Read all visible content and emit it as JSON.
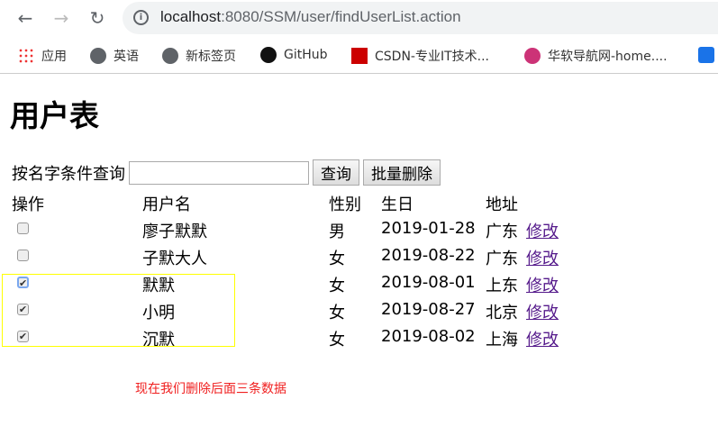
{
  "browser": {
    "url_host": "localhost",
    "url_rest": ":8080/SSM/user/findUserList.action",
    "bookmarks": [
      "应用",
      "英语",
      "新标签页",
      "GitHub",
      "CSDN-专业IT技术...",
      "华软导航网-home...."
    ]
  },
  "page": {
    "title": "用户表",
    "search_label": "按名字条件查询",
    "search_value": "",
    "query_button": "查询",
    "batch_delete_button": "批量删除",
    "headers": [
      "操作",
      "用户名",
      "性别",
      "生日",
      "地址"
    ],
    "rows": [
      {
        "checked": false,
        "name": "廖子默默",
        "gender": "男",
        "birthday": "2019-01-28",
        "address": "广东",
        "edit": "修改"
      },
      {
        "checked": false,
        "name": "子默大人",
        "gender": "女",
        "birthday": "2019-08-22",
        "address": "广东",
        "edit": "修改"
      },
      {
        "checked": true,
        "name": "默默",
        "gender": "女",
        "birthday": "2019-08-01",
        "address": "上东",
        "edit": "修改"
      },
      {
        "checked": true,
        "name": "小明",
        "gender": "女",
        "birthday": "2019-08-27",
        "address": "北京",
        "edit": "修改"
      },
      {
        "checked": true,
        "name": "沉默",
        "gender": "女",
        "birthday": "2019-08-02",
        "address": "上海",
        "edit": "修改"
      }
    ]
  },
  "annotation": "现在我们删除后面三条数据"
}
